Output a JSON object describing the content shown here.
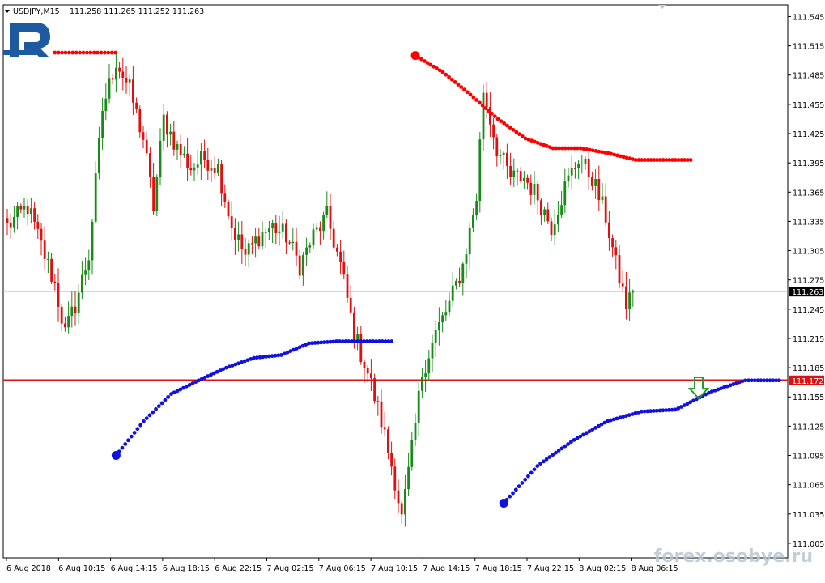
{
  "header": {
    "symbol_text": "USDJPY,M15",
    "ohlc_text": "111.258 111.265 111.252 111.263"
  },
  "watermark": "forex.osobye.ru",
  "logo_brand": "R",
  "colors": {
    "bull": "#1a8a1a",
    "bear": "#e01010",
    "support_dots": "#1010e0",
    "resistance_dots": "#ff0000",
    "level_line": "#e01010",
    "arrow": "#2a9a2a",
    "logo": "#1d5aa0"
  },
  "chart_data": {
    "type": "candlestick",
    "timeframe": "M15",
    "symbol": "USDJPY",
    "ylim": [
      110.99,
      111.557
    ],
    "y_ticks": [
      "111.545",
      "111.515",
      "111.485",
      "111.455",
      "111.425",
      "111.395",
      "111.365",
      "111.335",
      "111.305",
      "111.275",
      "111.245",
      "111.215",
      "111.185",
      "111.155",
      "111.125",
      "111.095",
      "111.065",
      "111.035",
      "111.005"
    ],
    "x_labels": [
      "6 Aug 2018",
      "6 Aug 10:15",
      "6 Aug 14:15",
      "6 Aug 18:15",
      "6 Aug 22:15",
      "7 Aug 02:15",
      "7 Aug 06:15",
      "7 Aug 10:15",
      "7 Aug 14:15",
      "7 Aug 18:15",
      "7 Aug 22:15",
      "8 Aug 02:15",
      "8 Aug 06:15"
    ],
    "current_price": "111.263",
    "level_price": "111.172",
    "close_anchors": [
      [
        0,
        111.33
      ],
      [
        6,
        111.35
      ],
      [
        10,
        111.31
      ],
      [
        14,
        111.27
      ],
      [
        17,
        111.22
      ],
      [
        20,
        111.25
      ],
      [
        24,
        111.3
      ],
      [
        28,
        111.45
      ],
      [
        32,
        111.5
      ],
      [
        36,
        111.47
      ],
      [
        40,
        111.42
      ],
      [
        43,
        111.35
      ],
      [
        46,
        111.44
      ],
      [
        50,
        111.41
      ],
      [
        54,
        111.39
      ],
      [
        58,
        111.4
      ],
      [
        62,
        111.39
      ],
      [
        66,
        111.33
      ],
      [
        70,
        111.3
      ],
      [
        74,
        111.32
      ],
      [
        78,
        111.33
      ],
      [
        82,
        111.32
      ],
      [
        86,
        111.29
      ],
      [
        90,
        111.32
      ],
      [
        94,
        111.34
      ],
      [
        98,
        111.29
      ],
      [
        102,
        111.22
      ],
      [
        106,
        111.18
      ],
      [
        110,
        111.13
      ],
      [
        114,
        111.07
      ],
      [
        116,
        111.03
      ],
      [
        119,
        111.1
      ],
      [
        122,
        111.18
      ],
      [
        126,
        111.22
      ],
      [
        130,
        111.25
      ],
      [
        134,
        111.29
      ],
      [
        138,
        111.36
      ],
      [
        140,
        111.47
      ],
      [
        144,
        111.41
      ],
      [
        148,
        111.38
      ],
      [
        152,
        111.38
      ],
      [
        156,
        111.36
      ],
      [
        160,
        111.33
      ],
      [
        164,
        111.37
      ],
      [
        168,
        111.4
      ],
      [
        172,
        111.38
      ],
      [
        176,
        111.34
      ],
      [
        179,
        111.29
      ],
      [
        182,
        111.25
      ],
      [
        184,
        111.26
      ]
    ],
    "resistance_dots": [
      {
        "x_bar": 14,
        "prices": [
          111.508,
          111.508
        ]
      },
      {
        "x_bar": 32,
        "prices": [
          111.508,
          111.508
        ]
      },
      {
        "x_bar": 120,
        "prices": [
          111.505,
          111.488,
          111.465,
          111.44,
          111.42,
          111.41,
          111.41,
          111.405,
          111.398,
          111.398,
          111.398
        ]
      }
    ],
    "support_dots": [
      {
        "x_bar": 32,
        "prices": [
          111.095,
          111.13,
          111.158,
          111.172,
          111.185,
          111.195,
          111.198,
          111.21,
          111.212,
          111.212,
          111.212
        ]
      },
      {
        "x_bar": 146,
        "prices": [
          111.046,
          111.085,
          111.11,
          111.13,
          111.14,
          111.142,
          111.16,
          111.172,
          111.172
        ]
      }
    ],
    "signal": "down-arrow"
  }
}
